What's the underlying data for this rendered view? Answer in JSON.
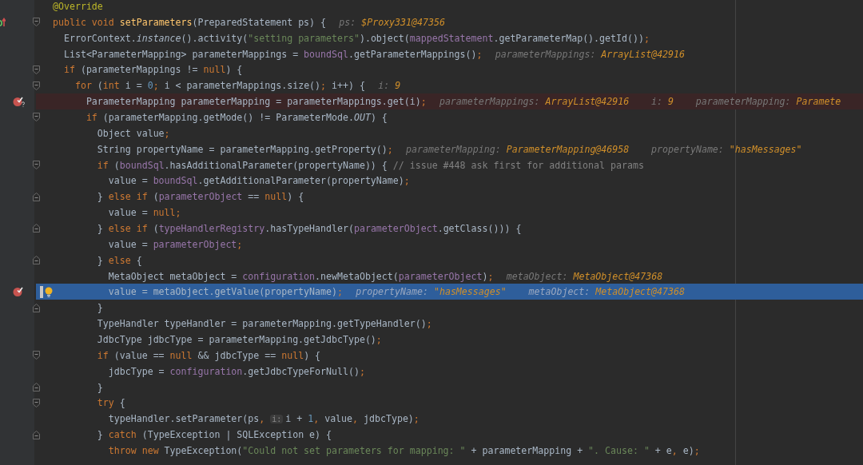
{
  "editor": {
    "lines": [
      {
        "selected": false,
        "tokens": [
          {
            "kind": "ann",
            "text": "@Override"
          }
        ]
      },
      {
        "selected": false,
        "gutter": {
          "kind": "override"
        },
        "fold": {
          "kind": "start"
        },
        "tokens": [
          {
            "kind": "kw",
            "text": "public void "
          },
          {
            "kind": "decl",
            "text": "setParameters"
          },
          {
            "kind": "plain",
            "text": "(PreparedStatement ps) {"
          }
        ],
        "hints": [
          {
            "name": "ps:",
            "value": "$Proxy331@47356"
          }
        ]
      },
      {
        "selected": false,
        "tokens": [
          {
            "kind": "plain",
            "text": "  ErrorContext."
          },
          {
            "kind": "ital",
            "text": "instance"
          },
          {
            "kind": "plain",
            "text": "().activity("
          },
          {
            "kind": "str",
            "text": "\"setting parameters\""
          },
          {
            "kind": "plain",
            "text": ").object("
          },
          {
            "kind": "fld",
            "text": "mappedStatement"
          },
          {
            "kind": "plain",
            "text": ".getParameterMap().getId())"
          },
          {
            "kind": "kw",
            "text": ";"
          }
        ]
      },
      {
        "selected": false,
        "tokens": [
          {
            "kind": "plain",
            "text": "  List<ParameterMapping> parameterMappings = "
          },
          {
            "kind": "fld",
            "text": "boundSql"
          },
          {
            "kind": "plain",
            "text": ".getParameterMappings()"
          },
          {
            "kind": "kw",
            "text": ";"
          }
        ],
        "hints": [
          {
            "name": "parameterMappings:",
            "value": "ArrayList@42916"
          }
        ]
      },
      {
        "selected": false,
        "fold": {
          "kind": "start"
        },
        "tokens": [
          {
            "kind": "kw",
            "text": "  if "
          },
          {
            "kind": "plain",
            "text": "(parameterMappings != "
          },
          {
            "kind": "kw",
            "text": "null"
          },
          {
            "kind": "plain",
            "text": ") {"
          }
        ]
      },
      {
        "selected": false,
        "fold": {
          "kind": "start"
        },
        "tokens": [
          {
            "kind": "kw",
            "text": "    for "
          },
          {
            "kind": "plain",
            "text": "("
          },
          {
            "kind": "kw",
            "text": "int "
          },
          {
            "kind": "plain",
            "text": "i = "
          },
          {
            "kind": "num",
            "text": "0"
          },
          {
            "kind": "kw",
            "text": "; "
          },
          {
            "kind": "plain",
            "text": "i < parameterMappings.size()"
          },
          {
            "kind": "kw",
            "text": "; "
          },
          {
            "kind": "plain",
            "text": "i++) {"
          }
        ],
        "hints": [
          {
            "name": "i:",
            "value": "9"
          }
        ]
      },
      {
        "selected": false,
        "gutter": {
          "kind": "conditional-breakpoint"
        },
        "tokens": [
          {
            "kind": "plain",
            "text": "      ParameterMapping parameterMapping = parameterMappings.get(i)"
          },
          {
            "kind": "kw",
            "text": ";"
          }
        ],
        "hints": [
          {
            "name": "parameterMappings:",
            "value": "ArrayList@42916"
          },
          {
            "name": "i:",
            "value": "9"
          },
          {
            "name": "parameterMapping:",
            "value": "Paramete"
          }
        ]
      },
      {
        "selected": false,
        "fold": {
          "kind": "start"
        },
        "tokens": [
          {
            "kind": "kw",
            "text": "      if "
          },
          {
            "kind": "plain",
            "text": "(parameterMapping.getMode() != ParameterMode."
          },
          {
            "kind": "ital",
            "text": "OUT"
          },
          {
            "kind": "plain",
            "text": ") {"
          }
        ]
      },
      {
        "selected": false,
        "tokens": [
          {
            "kind": "plain",
            "text": "        Object value"
          },
          {
            "kind": "kw",
            "text": ";"
          }
        ]
      },
      {
        "selected": false,
        "tokens": [
          {
            "kind": "plain",
            "text": "        String propertyName = parameterMapping.getProperty()"
          },
          {
            "kind": "kw",
            "text": ";"
          }
        ],
        "hints": [
          {
            "name": "parameterMapping:",
            "value": "ParameterMapping@46958"
          },
          {
            "name": "propertyName:",
            "value": "\"hasMessages\""
          }
        ]
      },
      {
        "selected": false,
        "fold": {
          "kind": "start"
        },
        "tokens": [
          {
            "kind": "kw",
            "text": "        if "
          },
          {
            "kind": "plain",
            "text": "("
          },
          {
            "kind": "fld",
            "text": "boundSql"
          },
          {
            "kind": "plain",
            "text": ".hasAdditionalParameter(propertyName)) { "
          },
          {
            "kind": "cmt",
            "text": "// issue #448 ask first for additional params"
          }
        ]
      },
      {
        "selected": false,
        "tokens": [
          {
            "kind": "plain",
            "text": "          value = "
          },
          {
            "kind": "fld",
            "text": "boundSql"
          },
          {
            "kind": "plain",
            "text": ".getAdditionalParameter(propertyName)"
          },
          {
            "kind": "kw",
            "text": ";"
          }
        ]
      },
      {
        "selected": false,
        "fold": {
          "kind": "end"
        },
        "tokens": [
          {
            "kind": "plain",
            "text": "        } "
          },
          {
            "kind": "kw",
            "text": "else if "
          },
          {
            "kind": "plain",
            "text": "("
          },
          {
            "kind": "fld",
            "text": "parameterObject"
          },
          {
            "kind": "plain",
            "text": " == "
          },
          {
            "kind": "kw",
            "text": "null"
          },
          {
            "kind": "plain",
            "text": ") {"
          }
        ]
      },
      {
        "selected": false,
        "tokens": [
          {
            "kind": "plain",
            "text": "          value = "
          },
          {
            "kind": "kw",
            "text": "null;"
          }
        ]
      },
      {
        "selected": false,
        "fold": {
          "kind": "end"
        },
        "tokens": [
          {
            "kind": "plain",
            "text": "        } "
          },
          {
            "kind": "kw",
            "text": "else if "
          },
          {
            "kind": "plain",
            "text": "("
          },
          {
            "kind": "fld",
            "text": "typeHandlerRegistry"
          },
          {
            "kind": "plain",
            "text": ".hasTypeHandler("
          },
          {
            "kind": "fld",
            "text": "parameterObject"
          },
          {
            "kind": "plain",
            "text": ".getClass())) {"
          }
        ]
      },
      {
        "selected": false,
        "tokens": [
          {
            "kind": "plain",
            "text": "          value = "
          },
          {
            "kind": "fld",
            "text": "parameterObject"
          },
          {
            "kind": "kw",
            "text": ";"
          }
        ]
      },
      {
        "selected": false,
        "fold": {
          "kind": "end"
        },
        "tokens": [
          {
            "kind": "plain",
            "text": "        } "
          },
          {
            "kind": "kw",
            "text": "else "
          },
          {
            "kind": "plain",
            "text": "{"
          }
        ]
      },
      {
        "selected": false,
        "tokens": [
          {
            "kind": "plain",
            "text": "          MetaObject metaObject = "
          },
          {
            "kind": "fld",
            "text": "configuration"
          },
          {
            "kind": "plain",
            "text": ".newMetaObject("
          },
          {
            "kind": "fld",
            "text": "parameterObject"
          },
          {
            "kind": "plain",
            "text": ")"
          },
          {
            "kind": "kw",
            "text": ";"
          }
        ],
        "hints": [
          {
            "name": "metaObject:",
            "value": "MetaObject@47368"
          }
        ]
      },
      {
        "selected": true,
        "gutter": {
          "kind": "breakpoint"
        },
        "tokens": [
          {
            "kind": "plain",
            "text": "          value = metaObject.getValue(propertyName)"
          },
          {
            "kind": "kw",
            "text": ";"
          }
        ],
        "hints": [
          {
            "name": "propertyName:",
            "value": "\"hasMessages\""
          },
          {
            "name": "metaObject:",
            "value": "MetaObject@47368"
          }
        ]
      },
      {
        "selected": false,
        "fold": {
          "kind": "end"
        },
        "tokens": [
          {
            "kind": "plain",
            "text": "        }"
          }
        ]
      },
      {
        "selected": false,
        "tokens": [
          {
            "kind": "plain",
            "text": "        TypeHandler typeHandler = parameterMapping.getTypeHandler()"
          },
          {
            "kind": "kw",
            "text": ";"
          }
        ]
      },
      {
        "selected": false,
        "tokens": [
          {
            "kind": "plain",
            "text": "        JdbcType jdbcType = parameterMapping.getJdbcType()"
          },
          {
            "kind": "kw",
            "text": ";"
          }
        ]
      },
      {
        "selected": false,
        "fold": {
          "kind": "start"
        },
        "tokens": [
          {
            "kind": "kw",
            "text": "        if "
          },
          {
            "kind": "plain",
            "text": "(value == "
          },
          {
            "kind": "kw",
            "text": "null "
          },
          {
            "kind": "plain",
            "text": "&& jdbcType == "
          },
          {
            "kind": "kw",
            "text": "null"
          },
          {
            "kind": "plain",
            "text": ") {"
          }
        ]
      },
      {
        "selected": false,
        "tokens": [
          {
            "kind": "plain",
            "text": "          jdbcType = "
          },
          {
            "kind": "fld",
            "text": "configuration"
          },
          {
            "kind": "plain",
            "text": ".getJdbcTypeForNull()"
          },
          {
            "kind": "kw",
            "text": ";"
          }
        ]
      },
      {
        "selected": false,
        "fold": {
          "kind": "end"
        },
        "tokens": [
          {
            "kind": "plain",
            "text": "        }"
          }
        ]
      },
      {
        "selected": false,
        "fold": {
          "kind": "start"
        },
        "tokens": [
          {
            "kind": "kw",
            "text": "        try "
          },
          {
            "kind": "plain",
            "text": "{"
          }
        ]
      },
      {
        "selected": false,
        "tokens": [
          {
            "kind": "plain",
            "text": "          typeHandler.setParameter(ps"
          },
          {
            "kind": "kw",
            "text": ", "
          },
          {
            "kind": "param",
            "text": "i:"
          },
          {
            "kind": "plain",
            "text": "i + "
          },
          {
            "kind": "num",
            "text": "1"
          },
          {
            "kind": "kw",
            "text": ", "
          },
          {
            "kind": "plain",
            "text": "value"
          },
          {
            "kind": "kw",
            "text": ", "
          },
          {
            "kind": "plain",
            "text": "jdbcType)"
          },
          {
            "kind": "kw",
            "text": ";"
          }
        ]
      },
      {
        "selected": false,
        "fold": {
          "kind": "end"
        },
        "tokens": [
          {
            "kind": "plain",
            "text": "        } "
          },
          {
            "kind": "kw",
            "text": "catch "
          },
          {
            "kind": "plain",
            "text": "(TypeException | SQLException e) {"
          }
        ]
      },
      {
        "selected": false,
        "tokens": [
          {
            "kind": "kw",
            "text": "          throw new "
          },
          {
            "kind": "plain",
            "text": "TypeException("
          },
          {
            "kind": "str",
            "text": "\"Could not set parameters for mapping: \""
          },
          {
            "kind": "plain",
            "text": " + parameterMapping + "
          },
          {
            "kind": "str",
            "text": "\". Cause: \""
          },
          {
            "kind": "plain",
            "text": " + e"
          },
          {
            "kind": "kw",
            "text": ", "
          },
          {
            "kind": "plain",
            "text": "e)"
          },
          {
            "kind": "kw",
            "text": ";"
          }
        ]
      }
    ]
  }
}
